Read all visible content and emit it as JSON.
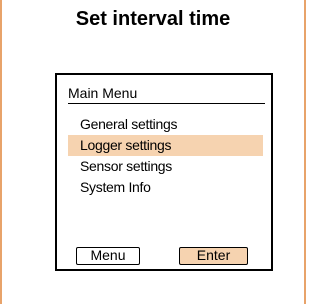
{
  "heading": "Set interval time",
  "device": {
    "menu_title": "Main Menu",
    "items": [
      {
        "label": "General settings",
        "selected": false
      },
      {
        "label": "Logger settings",
        "selected": true
      },
      {
        "label": "Sensor settings",
        "selected": false
      },
      {
        "label": "System Info",
        "selected": false
      }
    ],
    "buttons": {
      "menu": "Menu",
      "enter": "Enter"
    }
  },
  "colors": {
    "accent_border": "#e8a36a",
    "highlight": "#f6d3b0"
  }
}
